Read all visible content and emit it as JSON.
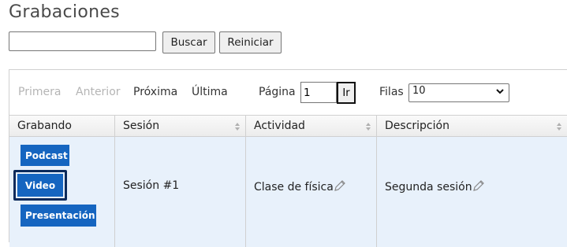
{
  "page": {
    "title": "Grabaciones"
  },
  "search": {
    "value": "",
    "search_label": "Buscar",
    "reset_label": "Reiniciar"
  },
  "pager": {
    "first": "Primera",
    "previous": "Anterior",
    "next": "Próxima",
    "last": "Última",
    "page_label": "Página",
    "page_value": "1",
    "go_label": "Ir",
    "rows_label": "Filas",
    "rows_value": "10"
  },
  "table": {
    "columns": [
      "Grabando",
      "Sesión",
      "Actividad",
      "Descripción"
    ],
    "rows": [
      {
        "recording_buttons": [
          "Podcast",
          "Video",
          "Presentación"
        ],
        "session": "Sesión #1",
        "activity": "Clase de física",
        "description": "Segunda sesión"
      }
    ]
  },
  "colors": {
    "primary_button": "#1565c0",
    "selected_row": "#e8f1fb",
    "focus_outline": "#0b2a5b",
    "disabled_text": "#b5b5b5"
  },
  "icons": {
    "sort": "sort-icon",
    "edit": "pencil-icon",
    "dropdown": "chevron-down-icon"
  }
}
